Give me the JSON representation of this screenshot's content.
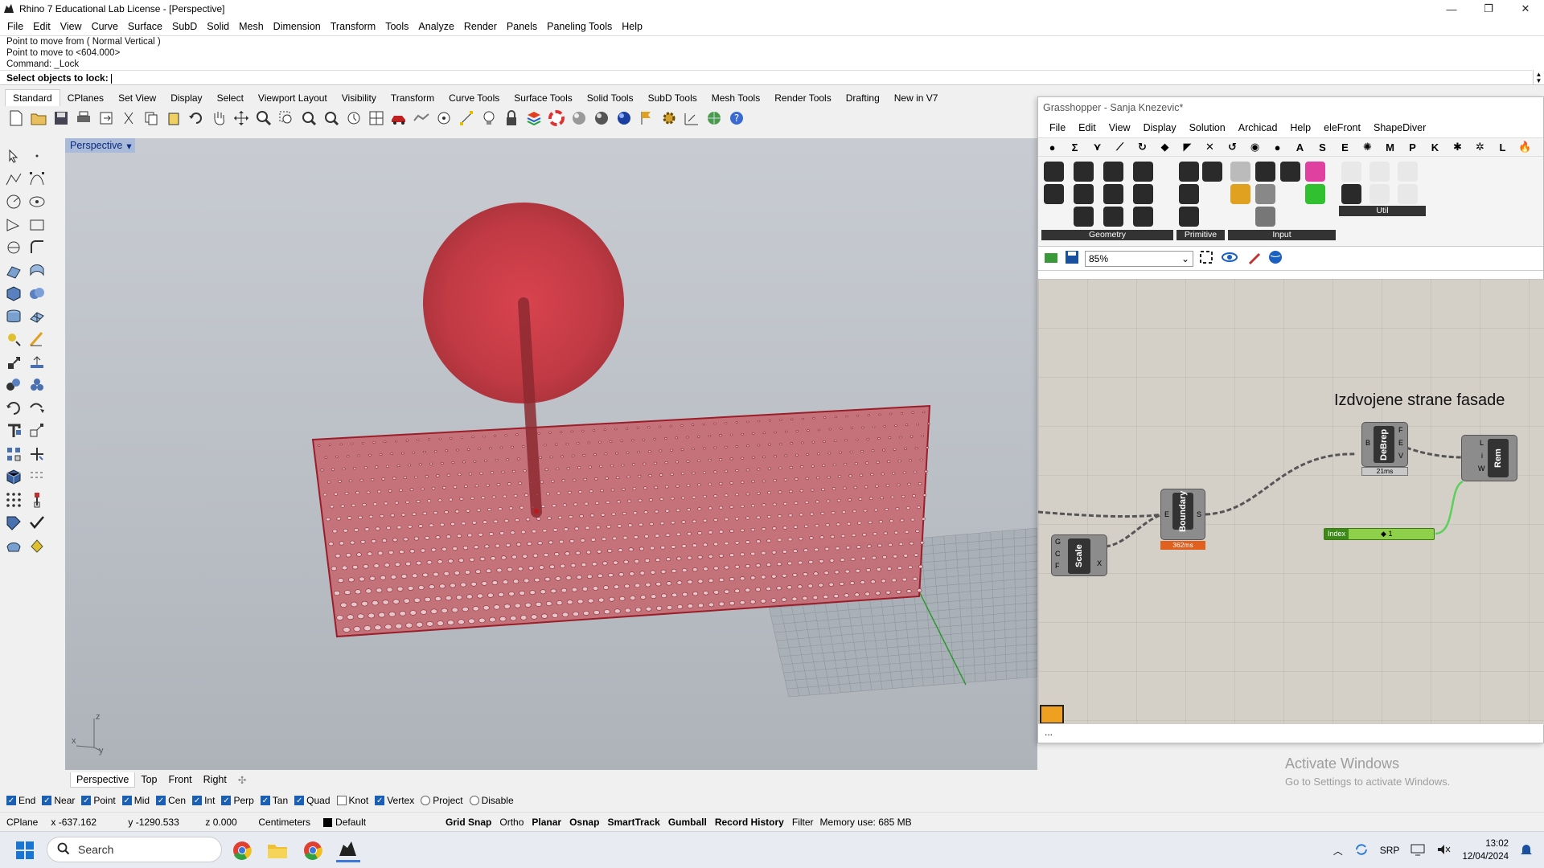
{
  "window": {
    "title": "Rhino 7 Educational Lab License - [Perspective]",
    "minimize": "—",
    "maximize": "❐",
    "close": "✕"
  },
  "menu": [
    "File",
    "Edit",
    "View",
    "Curve",
    "Surface",
    "SubD",
    "Solid",
    "Mesh",
    "Dimension",
    "Transform",
    "Tools",
    "Analyze",
    "Render",
    "Panels",
    "Paneling Tools",
    "Help"
  ],
  "command": {
    "history": [
      "Point to move from ( Normal  Vertical )",
      "Point to move to <604.000>",
      "Command: _Lock"
    ],
    "prompt": "Select objects to lock:"
  },
  "toolbar_tabs": [
    "Standard",
    "CPlanes",
    "Set View",
    "Display",
    "Select",
    "Viewport Layout",
    "Visibility",
    "Transform",
    "Curve Tools",
    "Surface Tools",
    "Solid Tools",
    "SubD Tools",
    "Mesh Tools",
    "Render Tools",
    "Drafting",
    "New in V7"
  ],
  "viewport": {
    "label": "Perspective",
    "axis_x": "x",
    "axis_y": "y",
    "axis_z": "z"
  },
  "viewport_tabs": [
    "Perspective",
    "Top",
    "Front",
    "Right"
  ],
  "osnaps": [
    {
      "label": "End",
      "checked": true
    },
    {
      "label": "Near",
      "checked": true
    },
    {
      "label": "Point",
      "checked": true
    },
    {
      "label": "Mid",
      "checked": true
    },
    {
      "label": "Cen",
      "checked": true
    },
    {
      "label": "Int",
      "checked": true
    },
    {
      "label": "Perp",
      "checked": true
    },
    {
      "label": "Tan",
      "checked": true
    },
    {
      "label": "Quad",
      "checked": true
    },
    {
      "label": "Knot",
      "checked": false
    },
    {
      "label": "Vertex",
      "checked": true
    },
    {
      "label": "Project",
      "checked": false
    },
    {
      "label": "Disable",
      "checked": false
    }
  ],
  "status": {
    "cplane": "CPlane",
    "x": "x -637.162",
    "y": "y -1290.533",
    "z": "z 0.000",
    "units": "Centimeters",
    "layer": "Default",
    "grid_snap": "Grid Snap",
    "ortho": "Ortho",
    "planar": "Planar",
    "osnap": "Osnap",
    "smarttrack": "SmartTrack",
    "gumball": "Gumball",
    "record_history": "Record History",
    "filter": "Filter",
    "memory": "Memory use: 685 MB"
  },
  "grasshopper": {
    "title": "Grasshopper - Sanja Knezevic*",
    "menu": [
      "File",
      "Edit",
      "View",
      "Display",
      "Solution",
      "Archicad",
      "Help",
      "eleFront",
      "ShapeDiver"
    ],
    "tabs": [
      "●",
      "Σ",
      "⋎",
      "⟋",
      "↻",
      "◆",
      "◤",
      "✕",
      "↺",
      "◉",
      "●",
      "A",
      "S",
      "E",
      "✺",
      "M",
      "P",
      "K",
      "✱",
      "✲",
      "L",
      "🔥"
    ],
    "groups": [
      "Geometry",
      "Primitive",
      "Input",
      "Util"
    ],
    "zoom": "85%",
    "canvas_title": "Izdvojene strane fasade",
    "components": {
      "scale": {
        "label": "Scale",
        "inputs": [
          "G",
          "C",
          "F"
        ],
        "output": "X"
      },
      "boundary": {
        "label": "Boundary",
        "inputs": [
          "E"
        ],
        "output": "S",
        "time": "362ms"
      },
      "debrep": {
        "label": "DeBrep",
        "inputs": [
          "B"
        ],
        "outputs": [
          "F",
          "E",
          "V"
        ],
        "time": "21ms"
      },
      "rem": {
        "label": "Rem",
        "inputs": [
          "L",
          "i",
          "W"
        ]
      },
      "index": {
        "label": "Index",
        "value": "◆ 1"
      }
    },
    "status": "..."
  },
  "activate": {
    "line1": "Activate Windows",
    "line2": "Go to Settings to activate Windows."
  },
  "taskbar": {
    "search": "Search",
    "lang": "SRP",
    "time": "13:02",
    "date": "12/04/2024"
  }
}
